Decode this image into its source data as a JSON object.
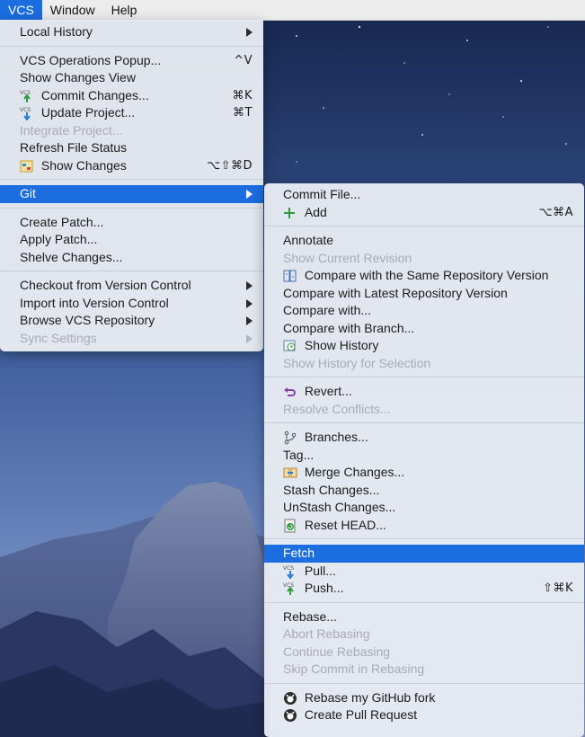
{
  "menubar": {
    "items": [
      {
        "label": "VCS",
        "active": true
      },
      {
        "label": "Window",
        "active": false
      },
      {
        "label": "Help",
        "active": false
      }
    ]
  },
  "vcs_menu": {
    "local_history": "Local History",
    "vcs_operations_popup": {
      "label": "VCS Operations Popup...",
      "shortcut": "^V"
    },
    "show_changes_view": "Show Changes View",
    "commit_changes": {
      "label": "Commit Changes...",
      "shortcut": "⌘K",
      "icon": "vcs-commit-icon"
    },
    "update_project": {
      "label": "Update Project...",
      "shortcut": "⌘T",
      "icon": "vcs-update-icon"
    },
    "integrate_project": "Integrate Project...",
    "refresh_file_status": "Refresh File Status",
    "show_changes": {
      "label": "Show Changes",
      "shortcut": "⌥⇧⌘D",
      "icon": "show-changes-icon"
    },
    "git": "Git",
    "create_patch": "Create Patch...",
    "apply_patch": "Apply Patch...",
    "shelve_changes": "Shelve Changes...",
    "checkout": "Checkout from Version Control",
    "import": "Import into Version Control",
    "browse_repo": "Browse VCS Repository",
    "sync_settings": "Sync Settings"
  },
  "git_menu": {
    "commit_file": "Commit File...",
    "add": {
      "label": "Add",
      "shortcut": "⌥⌘A",
      "icon": "plus-icon"
    },
    "annotate": "Annotate",
    "show_current_revision": "Show Current Revision",
    "compare_same_repo": {
      "label": "Compare with the Same Repository Version",
      "icon": "compare-icon"
    },
    "compare_latest": "Compare with Latest Repository Version",
    "compare_with": "Compare with...",
    "compare_branch": "Compare with Branch...",
    "show_history": {
      "label": "Show History",
      "icon": "history-icon"
    },
    "show_history_selection": "Show History for Selection",
    "revert": {
      "label": "Revert...",
      "icon": "revert-icon"
    },
    "resolve_conflicts": "Resolve Conflicts...",
    "branches": {
      "label": "Branches...",
      "icon": "branch-icon"
    },
    "tag": "Tag...",
    "merge_changes": {
      "label": "Merge Changes...",
      "icon": "merge-icon"
    },
    "stash_changes": "Stash Changes...",
    "unstash_changes": "UnStash Changes...",
    "reset_head": {
      "label": "Reset HEAD...",
      "icon": "reset-icon"
    },
    "fetch": "Fetch",
    "pull": {
      "label": "Pull...",
      "icon": "vcs-pull-icon"
    },
    "push": {
      "label": "Push...",
      "shortcut": "⇧⌘K",
      "icon": "vcs-push-icon"
    },
    "rebase": "Rebase...",
    "abort_rebasing": "Abort Rebasing",
    "continue_rebasing": "Continue Rebasing",
    "skip_commit": "Skip Commit in Rebasing",
    "rebase_fork": {
      "label": "Rebase my GitHub fork",
      "icon": "github-icon"
    },
    "create_pull_request": {
      "label": "Create Pull Request",
      "icon": "github-icon"
    }
  },
  "colors": {
    "highlight": "#1c6de0",
    "disabled_text": "#a9abb1",
    "menu_bg": "#e8ecf3"
  }
}
